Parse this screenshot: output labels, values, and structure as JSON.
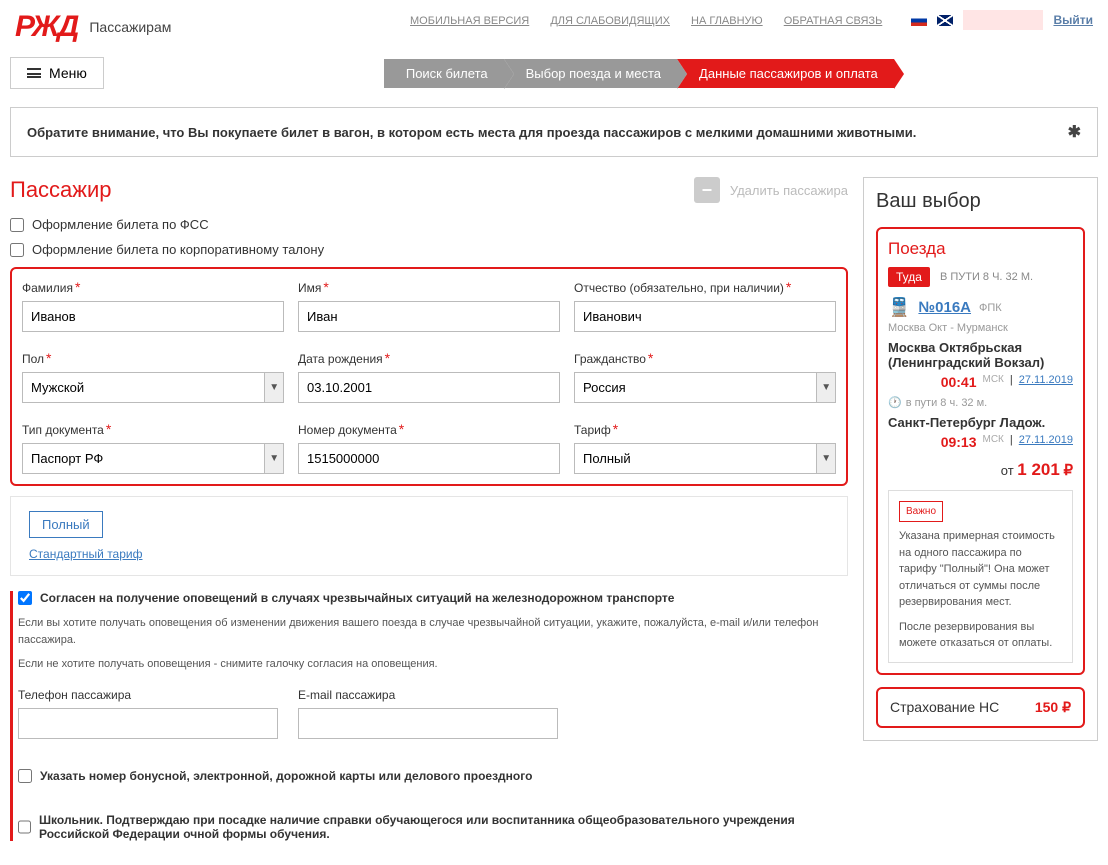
{
  "header": {
    "logo": "РЖД",
    "logo_sub": "Пассажирам",
    "links": {
      "mobile": "МОБИЛЬНАЯ ВЕРСИЯ",
      "accessibility": "ДЛЯ СЛАБОВИДЯЩИХ",
      "home": "НА ГЛАВНУЮ",
      "feedback": "ОБРАТНАЯ СВЯЗЬ"
    },
    "exit": "Выйти",
    "menu": "Меню"
  },
  "breadcrumb": {
    "step1": "Поиск билета",
    "step2": "Выбор поезда и места",
    "step3": "Данные пассажиров и оплата"
  },
  "notice": "Обратите внимание, что Вы покупаете билет в вагон, в котором есть места для проезда пассажиров с мелкими домашними животными.",
  "passenger": {
    "title": "Пассажир",
    "delete": "Удалить пассажира",
    "fss": "Оформление билета по ФСС",
    "corp": "Оформление билета по корпоративному талону",
    "labels": {
      "lastname": "Фамилия",
      "firstname": "Имя",
      "patronymic": "Отчество (обязательно, при наличии)",
      "gender": "Пол",
      "birthdate": "Дата рождения",
      "citizenship": "Гражданство",
      "doctype": "Тип документа",
      "docnum": "Номер документа",
      "tariff": "Тариф"
    },
    "values": {
      "lastname": "Иванов",
      "firstname": "Иван",
      "patronymic": "Иванович",
      "gender": "Мужской",
      "birthdate": "03.10.2001",
      "citizenship": "Россия",
      "doctype": "Паспорт РФ",
      "docnum": "1515000000",
      "tariff": "Полный"
    },
    "tariff_box": {
      "name": "Полный",
      "sub": "Стандартный тариф"
    },
    "consent": {
      "title": "Согласен на получение оповещений в случаях чрезвычайных ситуаций на железнодорожном транспорте",
      "text1": "Если вы хотите получать оповещения об изменении движения вашего поезда в случае чрезвычайной ситуации, укажите, пожалуйста, e-mail и/или телефон пассажира.",
      "text2": "Если не хотите получать оповещения - снимите галочку согласия на оповещения."
    },
    "contact": {
      "phone": "Телефон пассажира",
      "email": "E-mail пассажира"
    },
    "bonus": "Указать номер бонусной, электронной, дорожной карты или делового проездного",
    "school": "Школьник. Подтверждаю при посадке наличие справки обучающегося или воспитанника общеобразовательного учреждения Российской Федерации очной формы обучения."
  },
  "sidebar": {
    "title": "Ваш выбор",
    "trains_label": "Поезда",
    "direction": "Туда",
    "travel_time": "В ПУТИ 8 Ч. 32 М.",
    "train_num": "№016А",
    "operator": "ФПК",
    "route": "Москва Окт - Мурманск",
    "from_station": "Москва Октябрьская (Ленинградский Вокзал)",
    "from_time": "00:41",
    "from_tz": "МСК",
    "from_date": "27.11.2019",
    "duration": "в пути  8 ч. 32 м.",
    "to_station": "Санкт-Петербург Ладож.",
    "to_time": "09:13",
    "to_tz": "МСК",
    "to_date": "27.11.2019",
    "price_from": "от",
    "price": "1 201",
    "important_label": "Важно",
    "important_text1": "Указана примерная стоимость на одного пассажира по тарифу \"Полный\"! Она может отличаться от суммы после резервирования мест.",
    "important_text2": "После резервирования вы можете отказаться от оплаты.",
    "insurance_label": "Страхование НС",
    "insurance_price": "150"
  }
}
